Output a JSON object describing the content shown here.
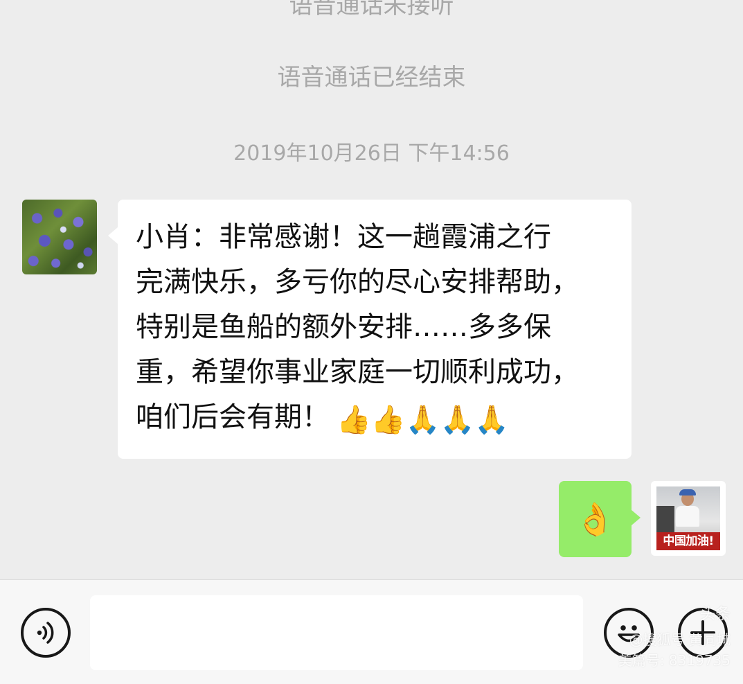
{
  "system_messages": {
    "call_not_answered": "语音通话未接听",
    "call_ended": "语音通话已经结束",
    "timestamp": "2019年10月26日 下午14:56"
  },
  "messages": [
    {
      "side": "left",
      "lines": [
        "小肖：非常感谢！这一趟霞浦之行",
        "完满快乐，多亏你的尽心安排帮助，",
        "特别是鱼船的额外安排……多多保",
        "重，希望你事业家庭一切顺利成功，",
        "咱们后会有期！"
      ],
      "emojis": [
        "👍",
        "👍",
        "🙏",
        "🙏",
        "🙏"
      ]
    },
    {
      "side": "right",
      "emoji": "👌"
    }
  ],
  "avatars": {
    "right_banner": "中国加油!"
  },
  "input_bar": {
    "voice_icon": "voice-icon",
    "emoji_icon": "smiley-icon",
    "plus_icon": "plus-icon"
  },
  "watermark": {
    "logo": "头条",
    "line1": "@搜狐号 黄同城",
    "line2": "美篇号: 8319735"
  },
  "colors": {
    "background": "#ededed",
    "incoming_bubble": "#ffffff",
    "outgoing_bubble": "#95ec69",
    "system_text": "#a8a8a8"
  }
}
